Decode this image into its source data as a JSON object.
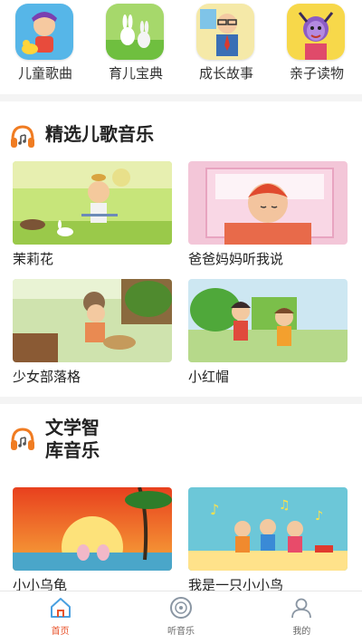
{
  "categories": [
    {
      "label": "儿童歌曲",
      "icon": "cartoon-kid-duck-icon"
    },
    {
      "label": "育儿宝典",
      "icon": "cartoon-rabbits-icon"
    },
    {
      "label": "成长故事",
      "icon": "cartoon-teacher-icon"
    },
    {
      "label": "亲子读物",
      "icon": "cartoon-girl-icon"
    }
  ],
  "sections": [
    {
      "title": "精选儿歌音乐",
      "items": [
        {
          "title": "茉莉花"
        },
        {
          "title": "爸爸妈妈听我说"
        },
        {
          "title": "少女部落格"
        },
        {
          "title": "小红帽"
        }
      ]
    },
    {
      "title_line1": "文学智",
      "title_line2": "库音乐",
      "items": [
        {
          "title": "小小乌龟"
        },
        {
          "title": "我是一只小小鸟"
        }
      ]
    }
  ],
  "nav": [
    {
      "label": "首页",
      "icon": "home-icon",
      "active": true
    },
    {
      "label": "听音乐",
      "icon": "disc-icon",
      "active": false
    },
    {
      "label": "我的",
      "icon": "user-icon",
      "active": false
    }
  ],
  "colors": {
    "accent": "#e8532b",
    "headphone": "#f07c22",
    "divider": "#f4f4f4"
  }
}
